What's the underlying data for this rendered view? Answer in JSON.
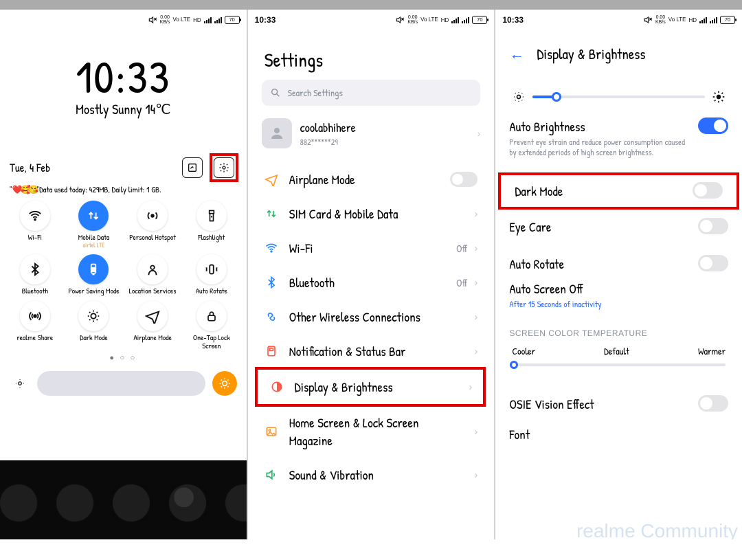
{
  "status": {
    "time": "10:33",
    "speed_top": "0.00",
    "speed_bottom": "KB/s",
    "volte": "Vo LTE",
    "hd": "HD",
    "battery": "70"
  },
  "panel1": {
    "time": "10:33",
    "weather": "Mostly Sunny 14℃",
    "date": "Tue, 4 Feb",
    "data_prefix": "\"",
    "data_emojis": "❤️🥰😘",
    "data_text": "\"Data used today: 429MB, Daily limit: 1 GB.",
    "tiles": [
      {
        "id": "wifi",
        "label": "Wi-Fi",
        "on": false
      },
      {
        "id": "mobile-data",
        "label": "Mobile Data",
        "sub": "airtel  LTE",
        "on": true
      },
      {
        "id": "hotspot",
        "label": "Personal Hotspot",
        "on": false
      },
      {
        "id": "flashlight",
        "label": "Flashlight",
        "on": false
      },
      {
        "id": "bluetooth",
        "label": "Bluetooth",
        "on": false
      },
      {
        "id": "power-saving",
        "label": "Power Saving Mode",
        "on": true
      },
      {
        "id": "location",
        "label": "Location Services",
        "on": false
      },
      {
        "id": "auto-rotate",
        "label": "Auto Rotate",
        "on": false
      },
      {
        "id": "realme-share",
        "label": "realme Share",
        "on": false
      },
      {
        "id": "dark-mode",
        "label": "Dark Mode",
        "on": false
      },
      {
        "id": "airplane",
        "label": "Airplane Mode",
        "on": false
      },
      {
        "id": "one-tap-lock",
        "label": "One-Tap Lock Screen",
        "on": false
      }
    ]
  },
  "panel2": {
    "title": "Settings",
    "search_placeholder": "Search Settings",
    "user": {
      "name": "coolabhihere",
      "id": "882******29"
    },
    "items": [
      {
        "id": "airplane-mode",
        "label": "Airplane Mode",
        "right": "toggle-off",
        "icon": "airplane"
      },
      {
        "id": "sim",
        "label": "SIM Card & Mobile Data",
        "right": "chev",
        "icon": "sim"
      },
      {
        "id": "wifi",
        "label": "Wi-Fi",
        "right": "Off",
        "icon": "wifi"
      },
      {
        "id": "bluetooth",
        "label": "Bluetooth",
        "right": "Off",
        "icon": "bluetooth"
      },
      {
        "id": "other-wireless",
        "label": "Other Wireless Connections",
        "right": "chev",
        "icon": "link"
      },
      {
        "id": "notif",
        "label": "Notification & Status Bar",
        "right": "chev",
        "icon": "notif"
      },
      {
        "id": "display",
        "label": "Display & Brightness",
        "right": "chev",
        "icon": "half-circle",
        "highlight": true
      },
      {
        "id": "home-lock",
        "label": "Home Screen & Lock Screen Magazine",
        "right": "chev",
        "icon": "picture"
      },
      {
        "id": "sound",
        "label": "Sound & Vibration",
        "right": "chev",
        "icon": "speaker"
      }
    ]
  },
  "panel3": {
    "title": "Display & Brightness",
    "brightness_value_pct": 14,
    "auto_brightness": {
      "label": "Auto Brightness",
      "sub": "Prevent eye strain and reduce power consumption caused by extended periods of high screen brightness.",
      "on": true
    },
    "dark_mode": {
      "label": "Dark Mode",
      "on": false
    },
    "eye_care": {
      "label": "Eye Care",
      "on": false
    },
    "auto_rotate": {
      "label": "Auto Rotate",
      "on": false
    },
    "auto_off": {
      "label": "Auto Screen Off",
      "sub": "After 15 Seconds of inactivity"
    },
    "sct_header": "SCREEN COLOR TEMPERATURE",
    "sct": {
      "cooler": "Cooler",
      "default": "Default",
      "warmer": "Warmer",
      "value_pct": 1
    },
    "osie": {
      "label": "OSIE Vision Effect",
      "on": false
    },
    "font_label": "Font",
    "watermark": "realme Community"
  }
}
